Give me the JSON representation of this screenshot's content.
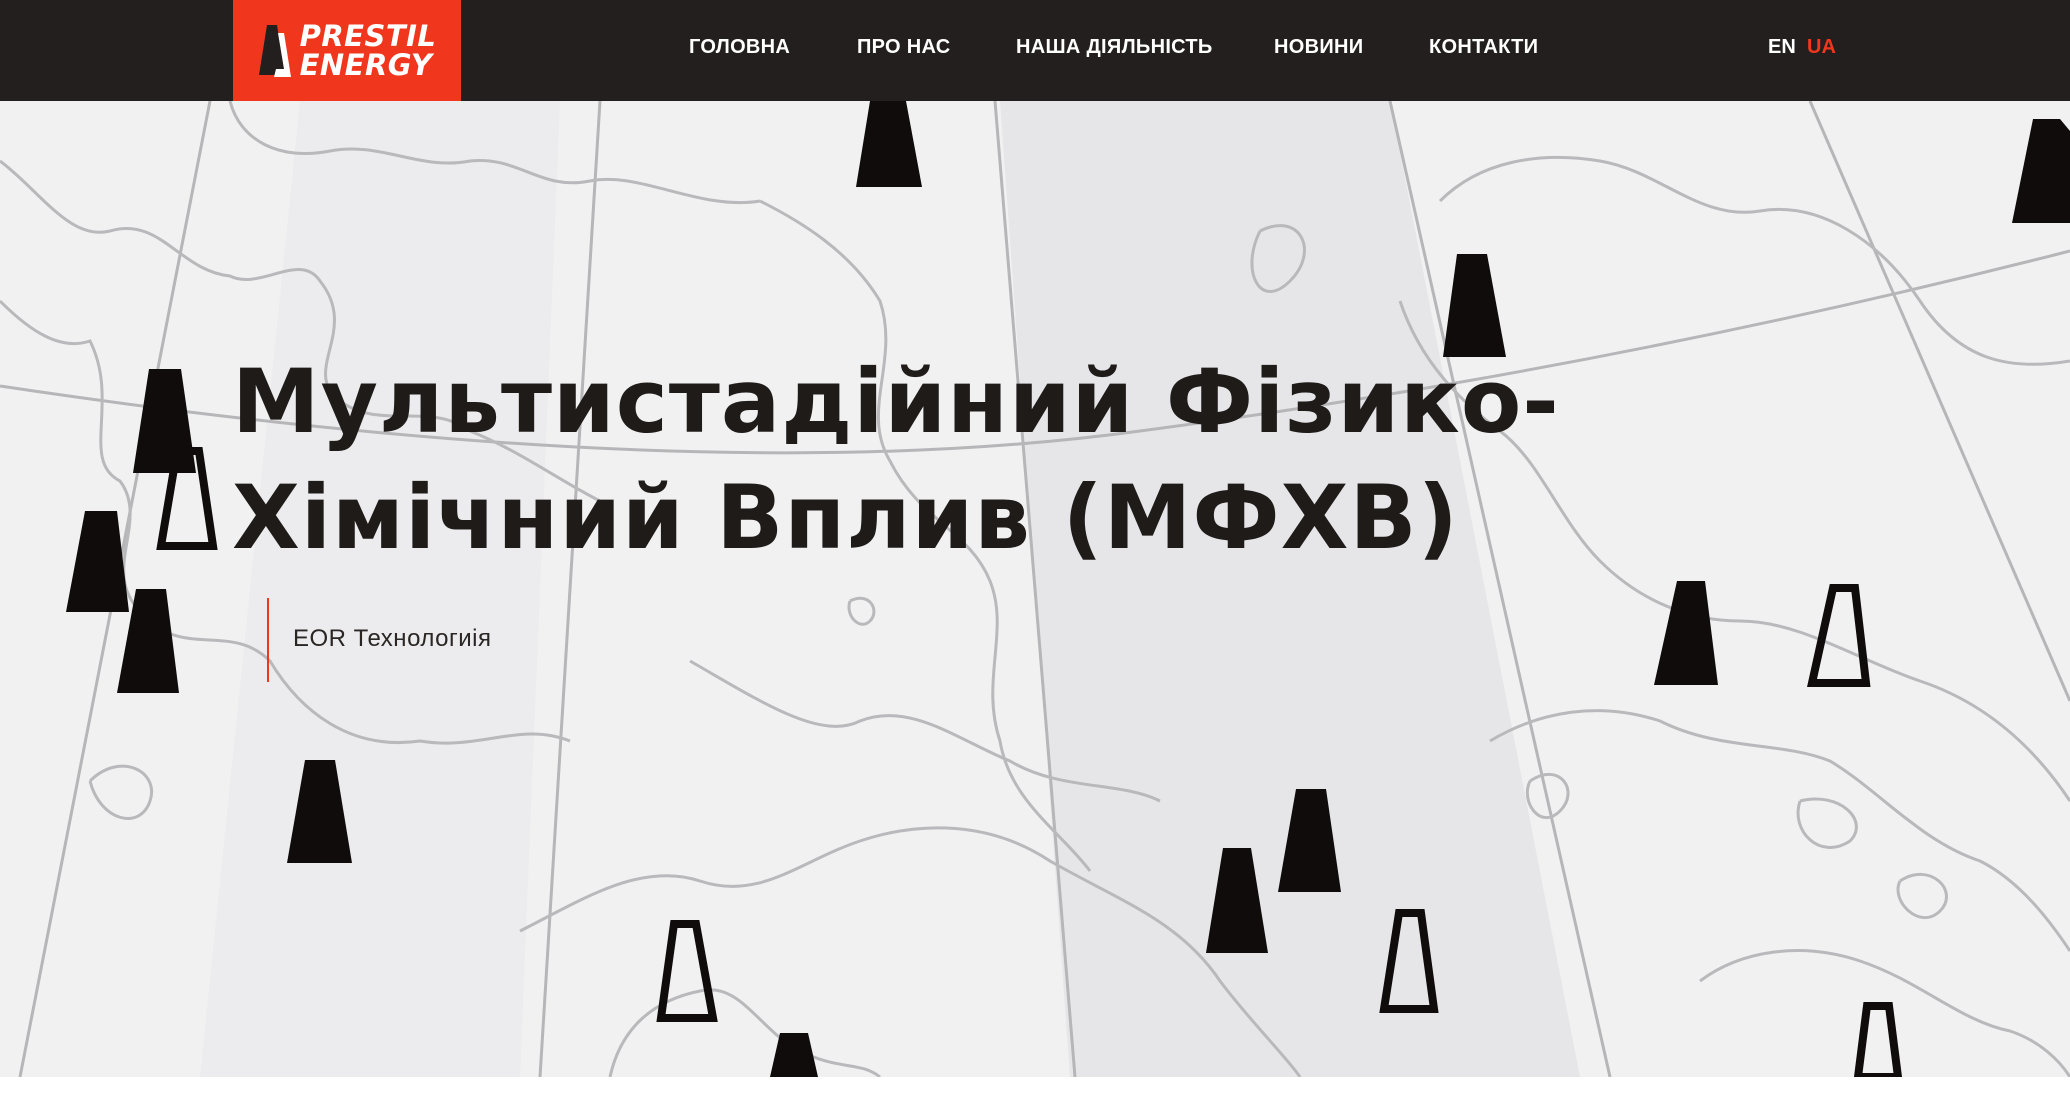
{
  "brand": {
    "line1": "PRESTIL",
    "line2": "ENERGY",
    "accent_color": "#f0371e",
    "header_bg": "#221f1e"
  },
  "nav": {
    "items": [
      {
        "label": "ГОЛОВНА"
      },
      {
        "label": "ПРО НАС"
      },
      {
        "label": "НАША ДІЯЛЬНІСТЬ"
      },
      {
        "label": "НОВИНИ"
      },
      {
        "label": "КОНТАКТИ"
      }
    ]
  },
  "lang": {
    "en": "EN",
    "ua": "UA",
    "active": "UA"
  },
  "hero": {
    "title_line1": "Мультистадійний Фізико-",
    "title_line2": "Хімічний Вплив (МФХВ)",
    "subtitle": "EOR Технологиія",
    "background": "#f1f1f2",
    "marker_icon": "oil-derrick-icon"
  }
}
